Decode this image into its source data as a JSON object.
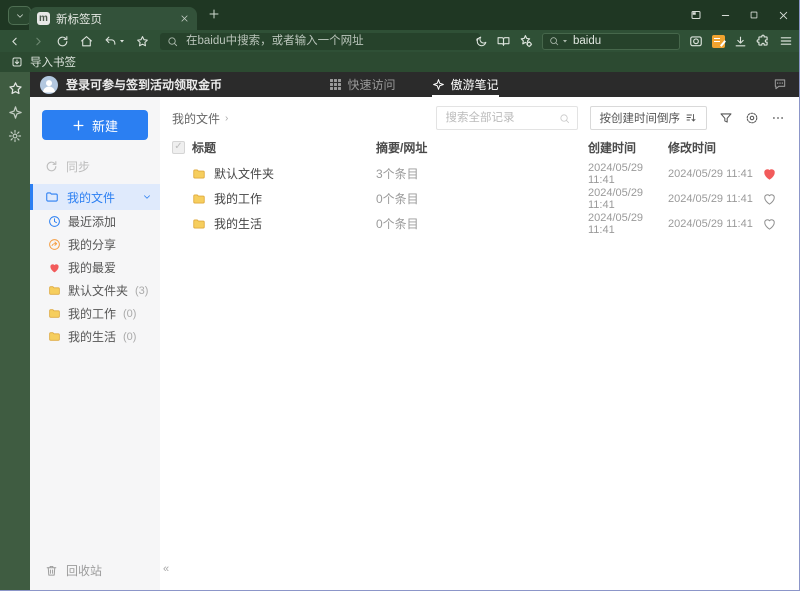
{
  "colors": {
    "accent_blue": "#2B7FF2",
    "favorite_red": "#F25B5B",
    "folder_yellow": "#F6CE5E",
    "chrome_green": "#2F5036",
    "header_dark": "#2B2B2B"
  },
  "browser": {
    "tab_title": "新标签页",
    "address_placeholder": "在baidu中搜索，或者输入一个网址",
    "search_value": "baidu",
    "import_label": "导入书签"
  },
  "app": {
    "login_banner": "登录可参与签到活动领取金币",
    "tabs": {
      "quick_access": "快速访问",
      "notes": "傲游笔记"
    },
    "sidebar": {
      "new_button": "新建",
      "sync": "同步",
      "my_files": "我的文件",
      "items": [
        {
          "label": "最近添加",
          "count": ""
        },
        {
          "label": "我的分享",
          "count": ""
        },
        {
          "label": "我的最爱",
          "count": ""
        },
        {
          "label": "默认文件夹",
          "count": "(3)"
        },
        {
          "label": "我的工作",
          "count": "(0)"
        },
        {
          "label": "我的生活",
          "count": "(0)"
        }
      ],
      "recycle_bin": "回收站"
    },
    "toolbar": {
      "breadcrumb": "我的文件",
      "search_placeholder": "搜索全部记录",
      "sort_label": "按创建时间倒序"
    },
    "table": {
      "headers": {
        "title": "标题",
        "summary": "摘要/网址",
        "created": "创建时间",
        "modified": "修改时间"
      },
      "rows": [
        {
          "title": "默认文件夹",
          "summary": "3个条目",
          "created": "2024/05/29 11:41",
          "modified": "2024/05/29 11:41",
          "favorite": true
        },
        {
          "title": "我的工作",
          "summary": "0个条目",
          "created": "2024/05/29 11:41",
          "modified": "2024/05/29 11:41",
          "favorite": false
        },
        {
          "title": "我的生活",
          "summary": "0个条目",
          "created": "2024/05/29 11:41",
          "modified": "2024/05/29 11:41",
          "favorite": false
        }
      ]
    }
  }
}
